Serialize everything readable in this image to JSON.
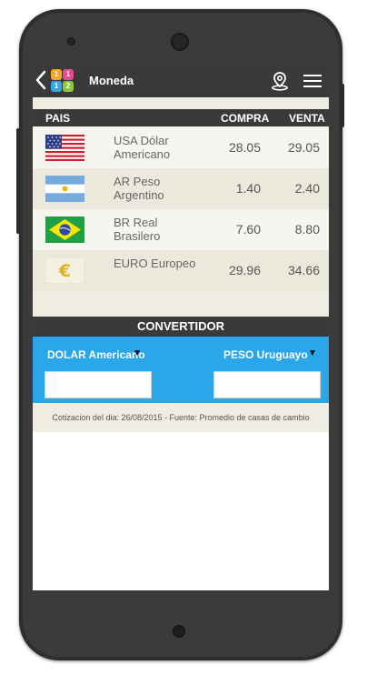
{
  "app": {
    "title": "Moneda"
  },
  "table": {
    "headers": {
      "country": "PAIS",
      "buy": "COMPRA",
      "sell": "VENTA"
    },
    "rows": [
      {
        "name": "USA Dólar Americano",
        "flag": "usa-flag-icon",
        "buy": "28.05",
        "sell": "29.05"
      },
      {
        "name": "AR Peso Argentino",
        "flag": "argentina-flag-icon",
        "buy": "1.40",
        "sell": "2.40"
      },
      {
        "name": "BR Real Brasilero",
        "flag": "brazil-flag-icon",
        "buy": "7.60",
        "sell": "8.80"
      },
      {
        "name": "EURO Europeo",
        "flag": "euro-icon",
        "buy": "29.96",
        "sell": "34.66"
      }
    ]
  },
  "converter": {
    "title": "CONVERTIDOR",
    "from_currency": "DOLAR Americano",
    "to_currency": "PESO Uruguayo",
    "from_value": "",
    "to_value": ""
  },
  "footer": {
    "note": "Cotizacion del dia: 26/08/2015 - Fuente: Promedio de casas de cambio"
  },
  "colors": {
    "appbar": "#3a3a3a",
    "converter_bg": "#2aa6ea",
    "table_bg": "#efece1"
  }
}
